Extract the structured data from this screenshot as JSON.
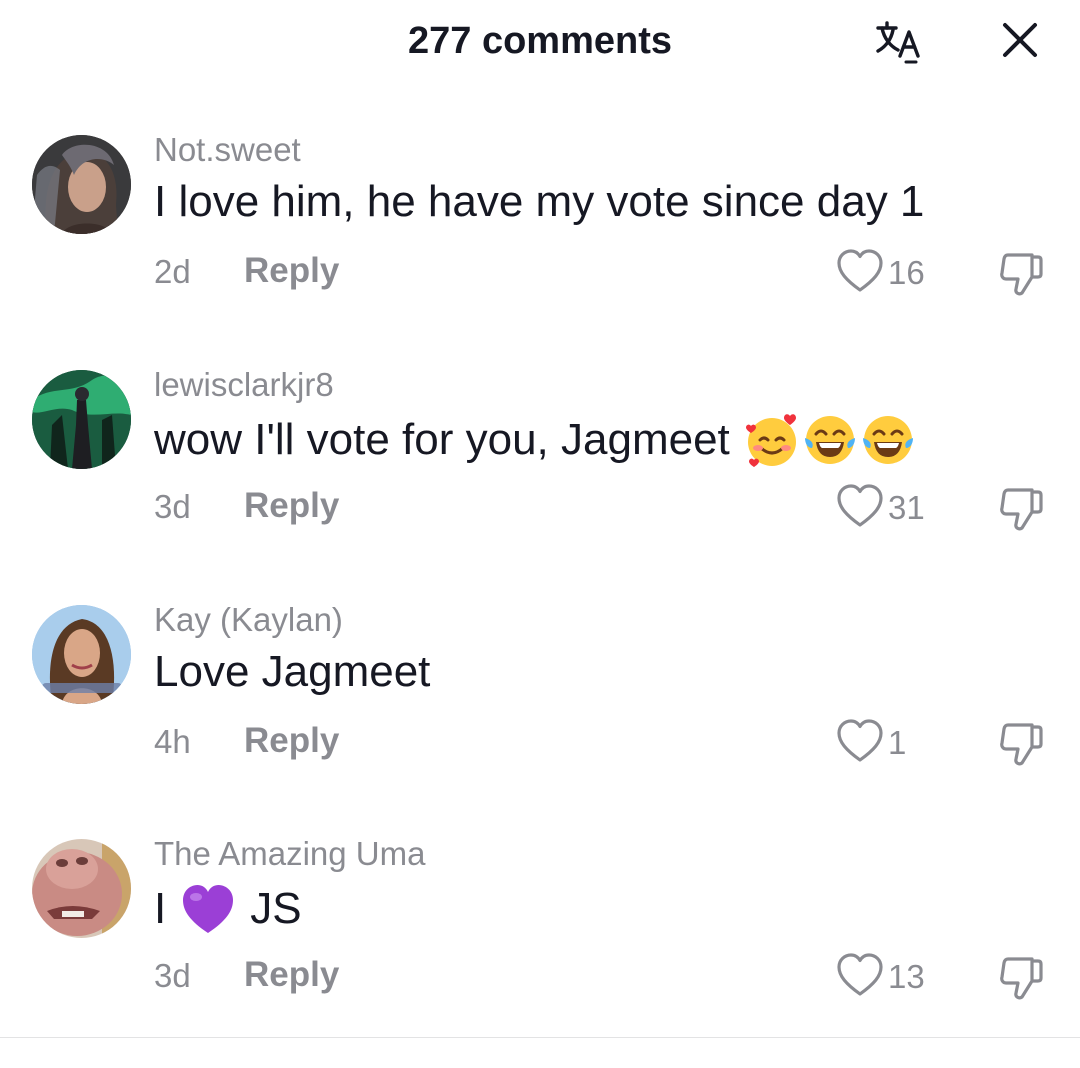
{
  "header": {
    "title": "277 comments"
  },
  "comments": [
    {
      "username": "Not.sweet",
      "text": "I love him, he have my vote since day 1",
      "time": "2d",
      "reply": "Reply",
      "likes": "16"
    },
    {
      "username": "lewisclarkjr8",
      "text": "wow I'll vote for you, Jagmeet",
      "time": "3d",
      "reply": "Reply",
      "likes": "31"
    },
    {
      "username": "Kay (Kaylan)",
      "text": "Love Jagmeet",
      "time": "4h",
      "reply": "Reply",
      "likes": "1"
    },
    {
      "username": "The Amazing Uma",
      "text_before": "I",
      "text_after": "JS",
      "time": "3d",
      "reply": "Reply",
      "likes": "13"
    }
  ],
  "colors": {
    "text": "#161823",
    "muted": "#8a8b91",
    "divider": "#e3e3e4"
  }
}
